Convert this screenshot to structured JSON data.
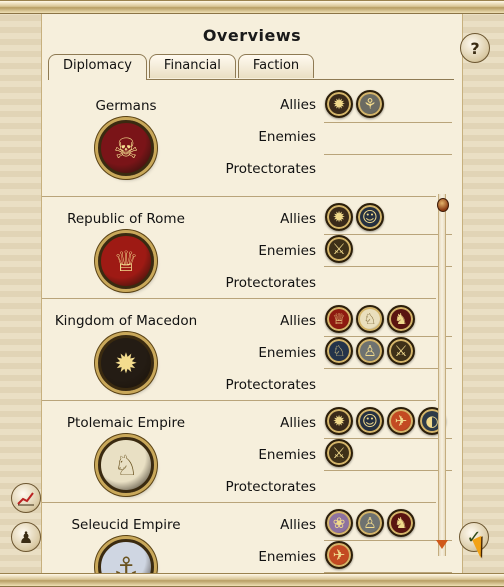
{
  "window": {
    "title": "Overviews"
  },
  "tabs": [
    {
      "label": "Diplomacy",
      "active": true
    },
    {
      "label": "Financial",
      "active": false
    },
    {
      "label": "Faction",
      "active": false
    }
  ],
  "relation_labels": {
    "allies": "Allies",
    "enemies": "Enemies",
    "protectorates": "Protectorates"
  },
  "factions": [
    {
      "name": "Germans",
      "emblem": "germans-emblem",
      "emblem_color": "#7a1418",
      "allies": [
        {
          "icon": "sun-emblem",
          "color": "#3a2a1a"
        },
        {
          "icon": "knot-emblem",
          "color": "#6b6b62"
        }
      ],
      "enemies": [],
      "protectorates": []
    },
    {
      "name": "Republic of Rome",
      "emblem": "roman-eagle-emblem",
      "emblem_color": "#9e1a14",
      "allies": [
        {
          "icon": "sun-emblem",
          "color": "#3a2a1a"
        },
        {
          "icon": "head-emblem",
          "color": "#253040"
        }
      ],
      "enemies": [
        {
          "icon": "warrior-emblem",
          "color": "#3e3018"
        }
      ],
      "protectorates": []
    },
    {
      "name": "Kingdom of Macedon",
      "emblem": "sun-emblem",
      "emblem_color": "#241c14",
      "allies": [
        {
          "icon": "eagle-emblem",
          "color": "#8e1a10"
        },
        {
          "icon": "ptolemaic-eagle-emblem",
          "color": "#eadfbd"
        },
        {
          "icon": "lion-emblem",
          "color": "#5a1410"
        }
      ],
      "enemies": [
        {
          "icon": "horse-emblem",
          "color": "#24334a"
        },
        {
          "icon": "figure-emblem",
          "color": "#6e7270"
        },
        {
          "icon": "warrior-emblem",
          "color": "#3e3018"
        }
      ],
      "protectorates": []
    },
    {
      "name": "Ptolemaic Empire",
      "emblem": "ptolemaic-eagle-emblem",
      "emblem_color": "#e9e0c4",
      "allies": [
        {
          "icon": "sun-emblem",
          "color": "#3a2a1a"
        },
        {
          "icon": "head-emblem",
          "color": "#253040"
        },
        {
          "icon": "bird-emblem",
          "color": "#c34a22"
        },
        {
          "icon": "partial-emblem",
          "color": "#2c3a48"
        }
      ],
      "enemies": [
        {
          "icon": "warrior-emblem",
          "color": "#3e3018"
        }
      ],
      "protectorates": []
    },
    {
      "name": "Seleucid Empire",
      "emblem": "anchor-emblem",
      "emblem_color": "#cfd6e2",
      "allies": [
        {
          "icon": "flower-emblem",
          "color": "#8d72a0"
        },
        {
          "icon": "figure-emblem",
          "color": "#6e7270"
        },
        {
          "icon": "lion-emblem",
          "color": "#5a1410"
        }
      ],
      "enemies": [
        {
          "icon": "bird-emblem",
          "color": "#c34a22"
        }
      ],
      "protectorates": []
    }
  ],
  "buttons": {
    "help": "?",
    "help_icon": "question-mark-icon",
    "graph_icon": "graph-icon",
    "statue_icon": "statue-icon",
    "confirm_icon": "checkmark-icon"
  }
}
